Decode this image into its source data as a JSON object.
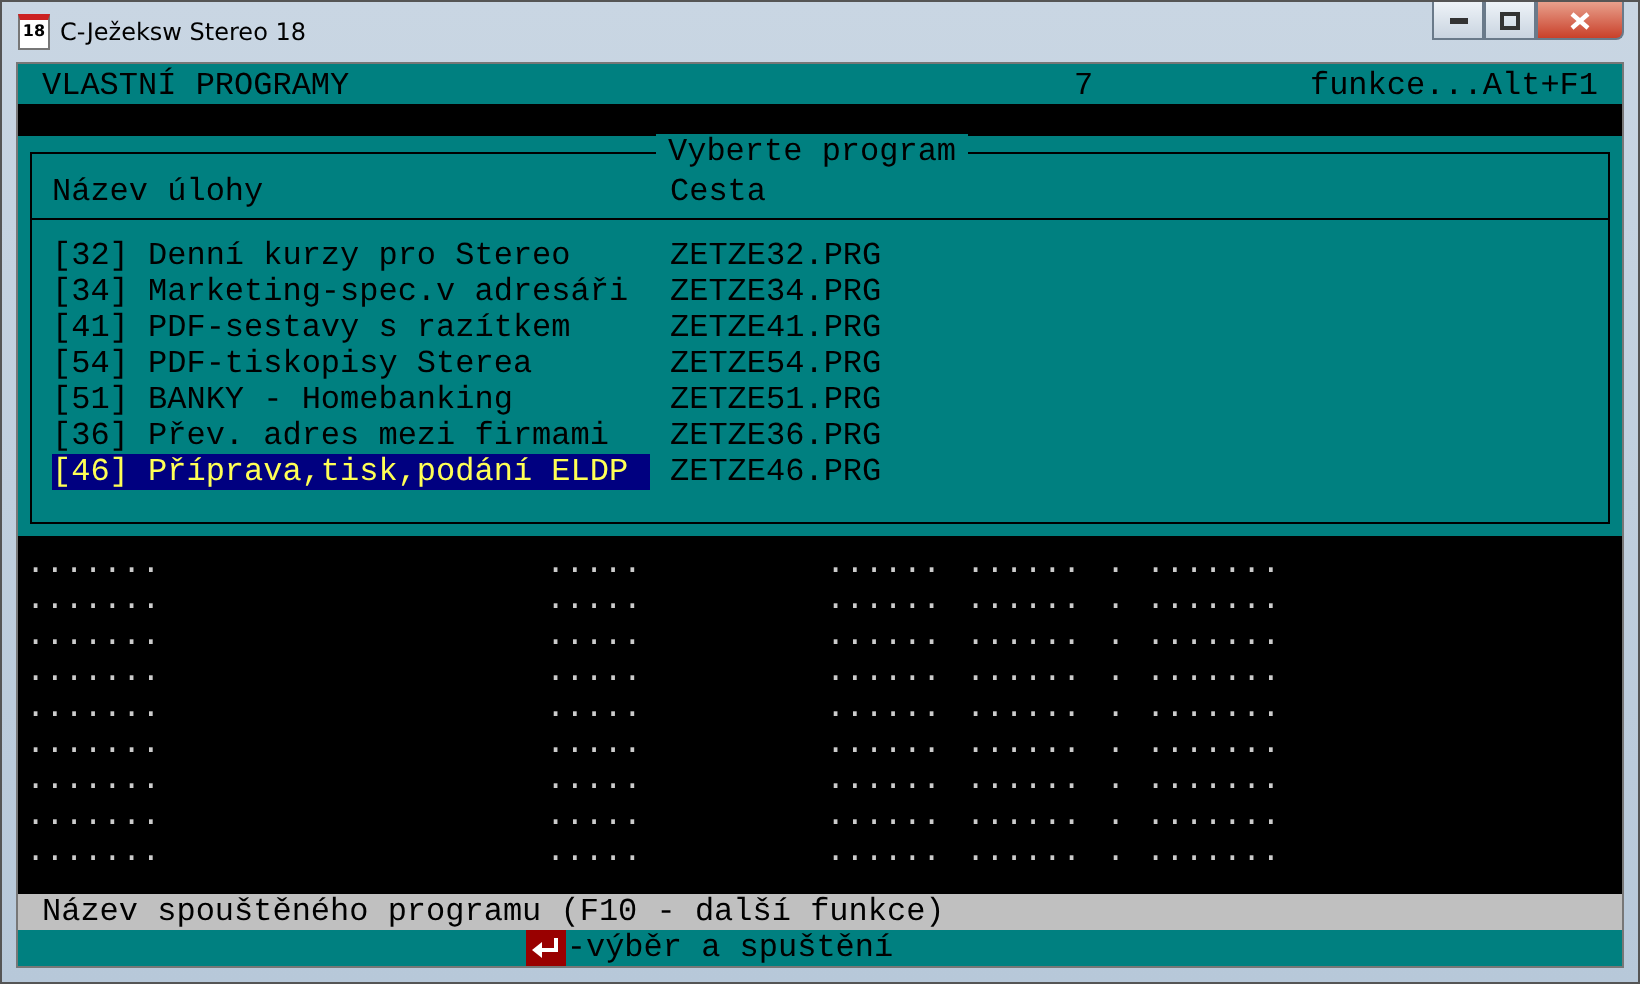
{
  "window": {
    "title": "C-Ježeksw Stereo 18",
    "icon_text": "18"
  },
  "header": {
    "title": "VLASTNÍ PROGRAMY",
    "count": "7",
    "hint": "funkce...Alt+F1"
  },
  "dialog": {
    "title": "Vyberte program",
    "columns": [
      "Název úlohy",
      "Cesta"
    ],
    "rows": [
      {
        "name": "[32] Denní kurzy pro Stereo",
        "path": "ZETZE32.PRG",
        "selected": false
      },
      {
        "name": "[34] Marketing-spec.v adresáři",
        "path": "ZETZE34.PRG",
        "selected": false
      },
      {
        "name": "[41] PDF-sestavy s razítkem",
        "path": "ZETZE41.PRG",
        "selected": false
      },
      {
        "name": "[54] PDF-tiskopisy Sterea",
        "path": "ZETZE54.PRG",
        "selected": false
      },
      {
        "name": "[51] BANKY - Homebanking",
        "path": "ZETZE51.PRG",
        "selected": false
      },
      {
        "name": "[36] Přev. adres mezi firmami",
        "path": "ZETZE36.PRG",
        "selected": false
      },
      {
        "name": "[46] Příprava,tisk,podání ELDP",
        "path": "ZETZE46.PRG",
        "selected": true
      }
    ]
  },
  "background_rows": [
    [
      ".......",
      ".....",
      "......",
      "......",
      ".",
      "......."
    ],
    [
      ".......",
      ".....",
      "......",
      "......",
      ".",
      "......."
    ],
    [
      ".......",
      ".....",
      "......",
      "......",
      ".",
      "......."
    ],
    [
      ".......",
      ".....",
      "......",
      "......",
      ".",
      "......."
    ],
    [
      ".......",
      ".....",
      "......",
      "......",
      ".",
      "......."
    ],
    [
      ".......",
      ".....",
      "......",
      "......",
      ".",
      "......."
    ],
    [
      ".......",
      ".....",
      "......",
      "......",
      ".",
      "......."
    ],
    [
      ".......",
      ".....",
      "......",
      "......",
      ".",
      "......."
    ],
    [
      ".......",
      ".....",
      "......",
      "......",
      ".",
      "......."
    ]
  ],
  "status_bar": "Název spouštěného programu (F10 - další funkce)",
  "footer": {
    "hint": "-výběr a spuštění"
  }
}
